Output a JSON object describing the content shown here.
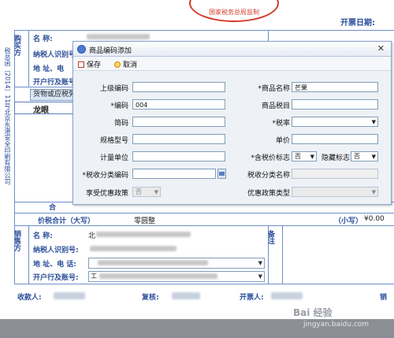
{
  "invoice": {
    "date_label": "开票日期:",
    "purchaser": "购买方",
    "left_side_text": "税总函〔2014〕11号北京东港安全印刷有限公司",
    "rows": {
      "name": "名    称:",
      "taxpayer_id": "纳税人识别号:",
      "address_phone": "地 址、电",
      "bank": "开户行及账号:"
    },
    "goods_header": "货物或应税劳",
    "goods_item": "龙眼",
    "total_label": "合",
    "tax_total_label": "价税合计（大写）",
    "tax_total_value": "零圆整",
    "small_label": "（小写）",
    "small_value": "¥0.00",
    "seller": "销售方",
    "seller_rows": {
      "name": "名    称:",
      "taxpayer_id": "纳税人识别号:",
      "address_phone": "地 址、电 话:",
      "bank": "开户行及账号:"
    },
    "seller_name_value": "北",
    "seller_bank_prefix": "工",
    "notes": "备注",
    "payee": "收款人:",
    "reviewer": "复核:",
    "issuer": "开票人:",
    "seller_short": "销",
    "stamp_text": "国家税务总局监制"
  },
  "dialog": {
    "title": "商品编码添加",
    "toolbar": {
      "save": "保存",
      "cancel": "取消"
    },
    "fields": {
      "parent_code": {
        "label": "上级编码",
        "value": ""
      },
      "code": {
        "label": "*编码",
        "value": "004"
      },
      "short_code": {
        "label": "简码",
        "value": ""
      },
      "spec": {
        "label": "规格型号",
        "value": ""
      },
      "unit": {
        "label": "计量单位",
        "value": ""
      },
      "tax_class_code": {
        "label": "*税收分类编码",
        "value": ""
      },
      "preferential": {
        "label": "享受优惠政策",
        "value": "否"
      },
      "product_name": {
        "label": "*商品名称",
        "value": "芒果"
      },
      "product_tax_item": {
        "label": "商品税目",
        "value": ""
      },
      "tax_rate": {
        "label": "*税率",
        "value": ""
      },
      "price": {
        "label": "单价",
        "value": ""
      },
      "tax_incl_flag": {
        "label": "*含税价标志",
        "value": "否"
      },
      "hidden_flag": {
        "label": "隐藏标志",
        "value": "否"
      },
      "tax_class_name": {
        "label": "税收分类名称",
        "value": ""
      },
      "pref_type": {
        "label": "优惠政策类型",
        "value": ""
      }
    }
  },
  "watermark": {
    "brand": "Bai  经验",
    "url": "jingyan.baidu.com"
  },
  "colors": {
    "form_blue": "#2b4e9a",
    "line": "#6d8fc9",
    "stamp_red": "#d23a2a"
  }
}
